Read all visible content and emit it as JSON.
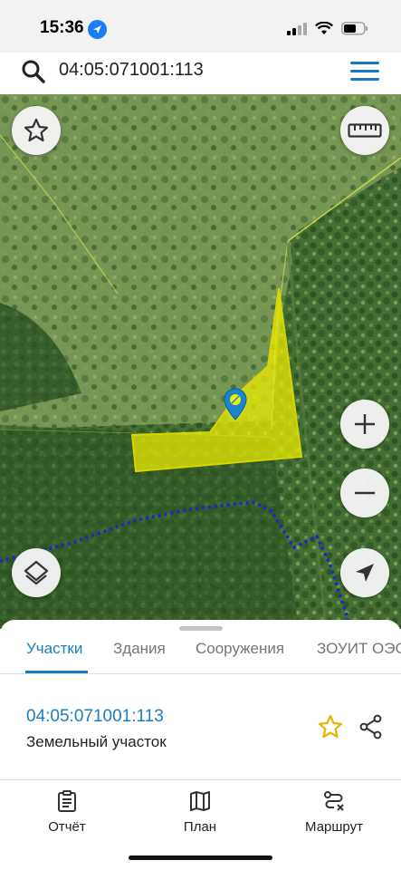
{
  "status_bar": {
    "time": "15:36"
  },
  "search": {
    "query": "04:05:071001:113"
  },
  "map": {
    "colors": {
      "forest": "#3f6a2f",
      "parcel_fill": "#f0f000",
      "parcel_border": "#c8c800",
      "boundary_dotted": "#1428d0",
      "boundary_line": "#c6d84a"
    },
    "icons": [
      "star-icon",
      "ruler-icon",
      "zoom-in-icon",
      "zoom-out-icon",
      "layers-icon",
      "location-arrow-icon",
      "map-marker-icon"
    ]
  },
  "sheet": {
    "tabs": [
      {
        "label": "Участки",
        "active": true
      },
      {
        "label": "Здания",
        "active": false
      },
      {
        "label": "Сооружения",
        "active": false
      },
      {
        "label": "ЗОУИТ ОЭС",
        "active": false
      }
    ],
    "parcel": {
      "number": "04:05:071001:113",
      "type": "Земельный участок"
    },
    "accent_color": "#1a7fc0",
    "favorite_color": "#e5b400"
  },
  "bottom_nav": [
    {
      "label": "Отчёт",
      "icon": "report-icon"
    },
    {
      "label": "План",
      "icon": "map-plan-icon"
    },
    {
      "label": "Маршрут",
      "icon": "route-icon"
    }
  ]
}
